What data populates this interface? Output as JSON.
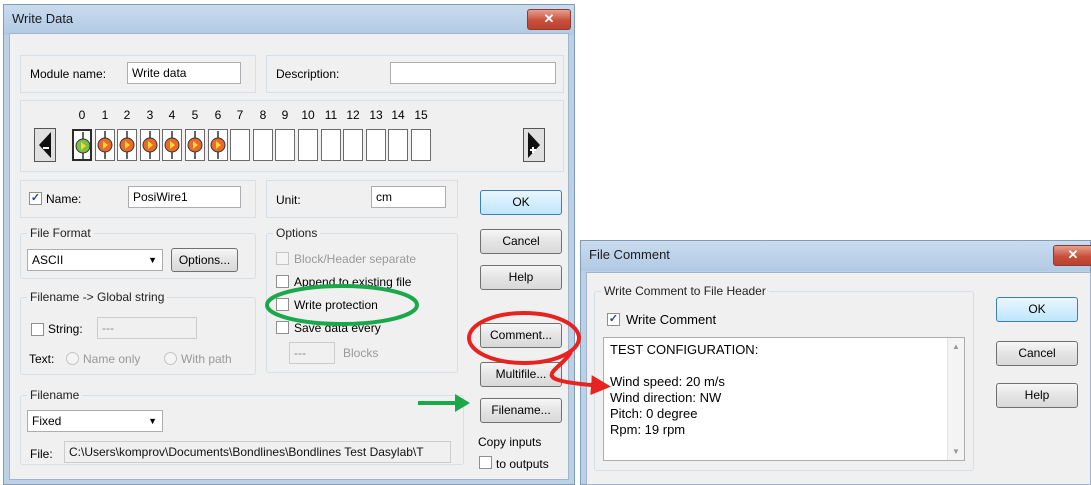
{
  "write_dialog": {
    "title": "Write Data",
    "close_glyph": "✕",
    "module_name_label": "Module name:",
    "module_name_value": "Write data",
    "description_label": "Description:",
    "description_value": "",
    "channels": [
      "0",
      "1",
      "2",
      "3",
      "4",
      "5",
      "6",
      "7",
      "8",
      "9",
      "10",
      "11",
      "12",
      "13",
      "14",
      "15"
    ],
    "channel_state": [
      "selected",
      "connected",
      "connected",
      "connected",
      "connected",
      "connected",
      "connected",
      "empty",
      "empty",
      "empty",
      "empty",
      "empty",
      "empty",
      "empty",
      "empty",
      "empty"
    ],
    "name_label": "Name:",
    "name_checked": true,
    "name_value": "PosiWire1",
    "unit_label": "Unit:",
    "unit_value": "cm",
    "ok": "OK",
    "cancel": "Cancel",
    "help": "Help",
    "comment": "Comment...",
    "multifile": "Multifile...",
    "filename_btn": "Filename...",
    "file_format": {
      "legend": "File Format",
      "value": "ASCII",
      "options_button": "Options..."
    },
    "options": {
      "legend": "Options",
      "block_header": "Block/Header separate",
      "append": "Append to existing file",
      "write_protection": "Write protection",
      "save_every": "Save data every",
      "blocks_value": "---",
      "blocks_label": "Blocks"
    },
    "global_string": {
      "legend": "Filename -> Global string",
      "string_label": "String:",
      "string_value": "---",
      "text_label": "Text:",
      "name_only": "Name only",
      "with_path": "With path"
    },
    "filename_group": {
      "legend": "Filename",
      "mode": "Fixed",
      "file_label": "File:",
      "file_path": "C:\\Users\\komprov\\Documents\\Bondlines\\Bondlines Test Dasylab\\T"
    },
    "copy_inputs_line1": "Copy inputs",
    "copy_inputs_line2": "to outputs"
  },
  "comment_dialog": {
    "title": "File Comment",
    "close_glyph": "✕",
    "group_legend": "Write Comment to File Header",
    "write_comment_label": "Write Comment",
    "write_comment_checked": true,
    "lines": [
      "TEST CONFIGURATION:",
      "",
      "Wind speed: 20 m/s",
      "Wind direction: NW",
      "Pitch: 0 degree",
      "Rpm: 19 rpm"
    ],
    "ok": "OK",
    "cancel": "Cancel",
    "help": "Help"
  },
  "annotations": {
    "ellipse_color": "#1aa84a",
    "circle_color": "#e8231f",
    "arrow_red": "#e8231f",
    "arrow_green": "#1aa84a"
  }
}
